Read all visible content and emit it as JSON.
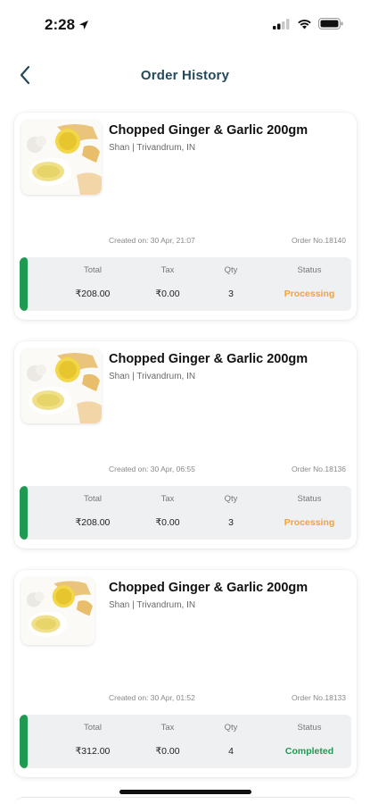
{
  "status_bar": {
    "time": "2:28"
  },
  "header": {
    "title": "Order History"
  },
  "orders": [
    {
      "product_name": "Chopped Ginger & Garlic 200gm",
      "seller": "Shan | Trivandrum, IN",
      "created_on": "Created on: 30 Apr, 21:07",
      "order_no": "Order No.18140",
      "total_label": "Total",
      "total": "₹208.00",
      "tax_label": "Tax",
      "tax": "₹0.00",
      "qty_label": "Qty",
      "qty": "3",
      "status_label": "Status",
      "status": "Processing",
      "status_color": "#f5a23a"
    },
    {
      "product_name": "Chopped Ginger & Garlic 200gm",
      "seller": "Shan | Trivandrum, IN",
      "created_on": "Created on: 30 Apr, 06:55",
      "order_no": "Order No.18136",
      "total_label": "Total",
      "total": "₹208.00",
      "tax_label": "Tax",
      "tax": "₹0.00",
      "qty_label": "Qty",
      "qty": "3",
      "status_label": "Status",
      "status": "Processing",
      "status_color": "#f5a23a"
    },
    {
      "product_name": "Chopped Ginger & Garlic 200gm",
      "seller": "Shan | Trivandrum, IN",
      "created_on": "Created on: 30 Apr, 01:52",
      "order_no": "Order No.18133",
      "total_label": "Total",
      "total": "₹312.00",
      "tax_label": "Tax",
      "tax": "₹0.00",
      "qty_label": "Qty",
      "qty": "4",
      "status_label": "Status",
      "status": "Completed",
      "status_color": "#1e9a52"
    }
  ],
  "colors": {
    "title": "#24495a",
    "accent_green": "#1e9a52",
    "processing": "#f5a23a",
    "summary_bg": "#eef0f2"
  },
  "icons": {
    "back": "chevron-left-icon",
    "location": "location-arrow-icon",
    "signal": "cellular-signal-icon",
    "wifi": "wifi-icon",
    "battery": "battery-icon"
  }
}
